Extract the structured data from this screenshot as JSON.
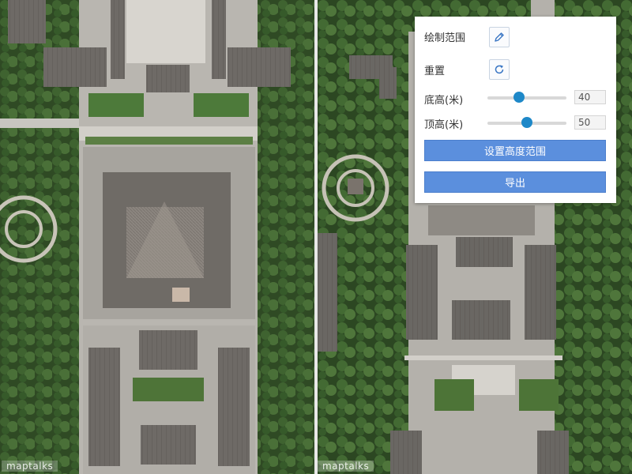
{
  "maps": {
    "left_watermark": "maptalks",
    "right_watermark": "maptalks"
  },
  "panel": {
    "draw_label": "绘制范围",
    "draw_icon": "pencil-icon",
    "reset_label": "重置",
    "reset_icon": "refresh-icon",
    "bottom_height": {
      "label": "底高(米)",
      "value": "40",
      "fraction": 0.4
    },
    "top_height": {
      "label": "顶高(米)",
      "value": "50",
      "fraction": 0.5
    },
    "set_range_button": "设置高度范围",
    "export_button": "导出"
  },
  "colors": {
    "accent": "#5b8fdd",
    "slider_thumb": "#1e88c8"
  }
}
